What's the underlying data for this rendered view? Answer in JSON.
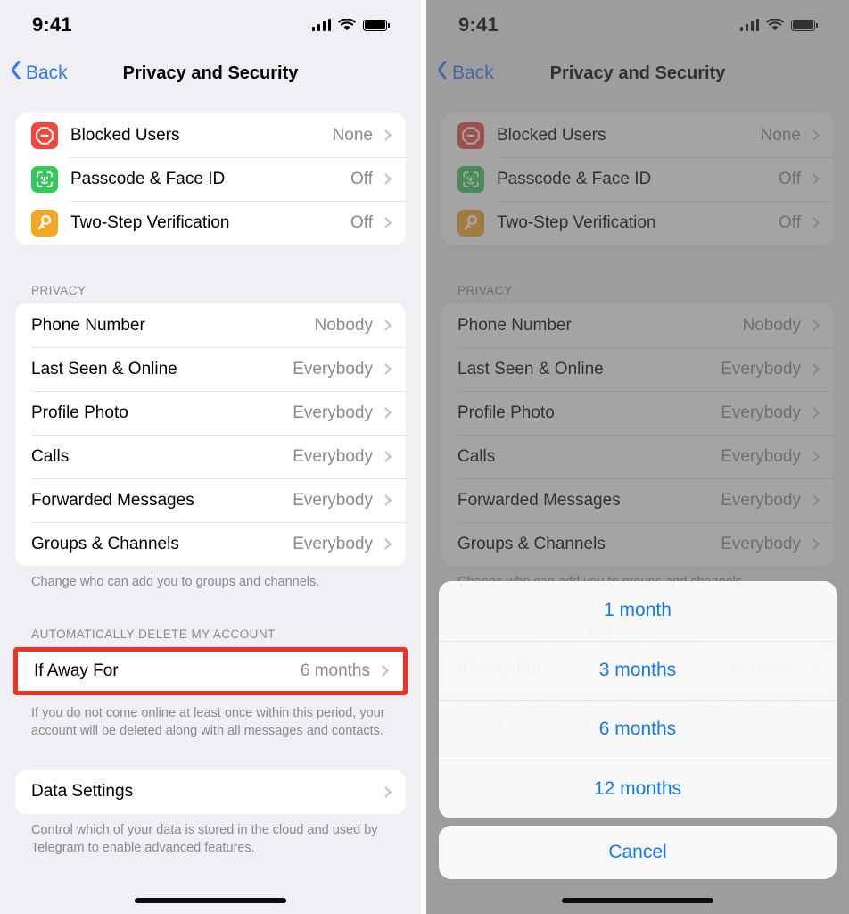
{
  "accent_colors": {
    "ios_blue": "#007AFF",
    "back_blue": "#3478f6",
    "highlight_red": "#f4311f",
    "page_background": "#efeff4",
    "card_white": "#ffffff",
    "secondary_text": "#8a8a8e",
    "dim_overlay": "#5a5a5a"
  },
  "status_bar": {
    "time": "9:41",
    "icons": [
      "cellular-signal-icon",
      "wifi-icon",
      "battery-icon"
    ]
  },
  "nav": {
    "back_label": "Back",
    "title": "Privacy and Security"
  },
  "security_group": {
    "rows": [
      {
        "icon": "blocked-users-icon",
        "label": "Blocked Users",
        "value": "None"
      },
      {
        "icon": "face-id-icon",
        "label": "Passcode & Face ID",
        "value": "Off"
      },
      {
        "icon": "key-icon",
        "label": "Two-Step Verification",
        "value": "Off"
      }
    ]
  },
  "privacy_section": {
    "header": "PRIVACY",
    "rows": [
      {
        "label": "Phone Number",
        "value": "Nobody"
      },
      {
        "label": "Last Seen & Online",
        "value": "Everybody"
      },
      {
        "label": "Profile Photo",
        "value": "Everybody"
      },
      {
        "label": "Calls",
        "value": "Everybody"
      },
      {
        "label": "Forwarded Messages",
        "value": "Everybody"
      },
      {
        "label": "Groups & Channels",
        "value": "Everybody"
      }
    ],
    "footer": "Change who can add you to groups and channels."
  },
  "auto_delete_section": {
    "header": "AUTOMATICALLY DELETE MY ACCOUNT",
    "row": {
      "label": "If Away For",
      "value": "6 months"
    },
    "footer": "If you do not come online at least once within this period, your account will be deleted along with all messages and contacts.",
    "highlighted": true
  },
  "data_settings_section": {
    "row": {
      "label": "Data Settings",
      "value": ""
    },
    "footer": "Control which of your data is stored in the cloud and used by Telegram to enable advanced features."
  },
  "action_sheet": {
    "options": [
      "1 month",
      "3 months",
      "6 months",
      "12 months"
    ],
    "cancel_label": "Cancel"
  }
}
